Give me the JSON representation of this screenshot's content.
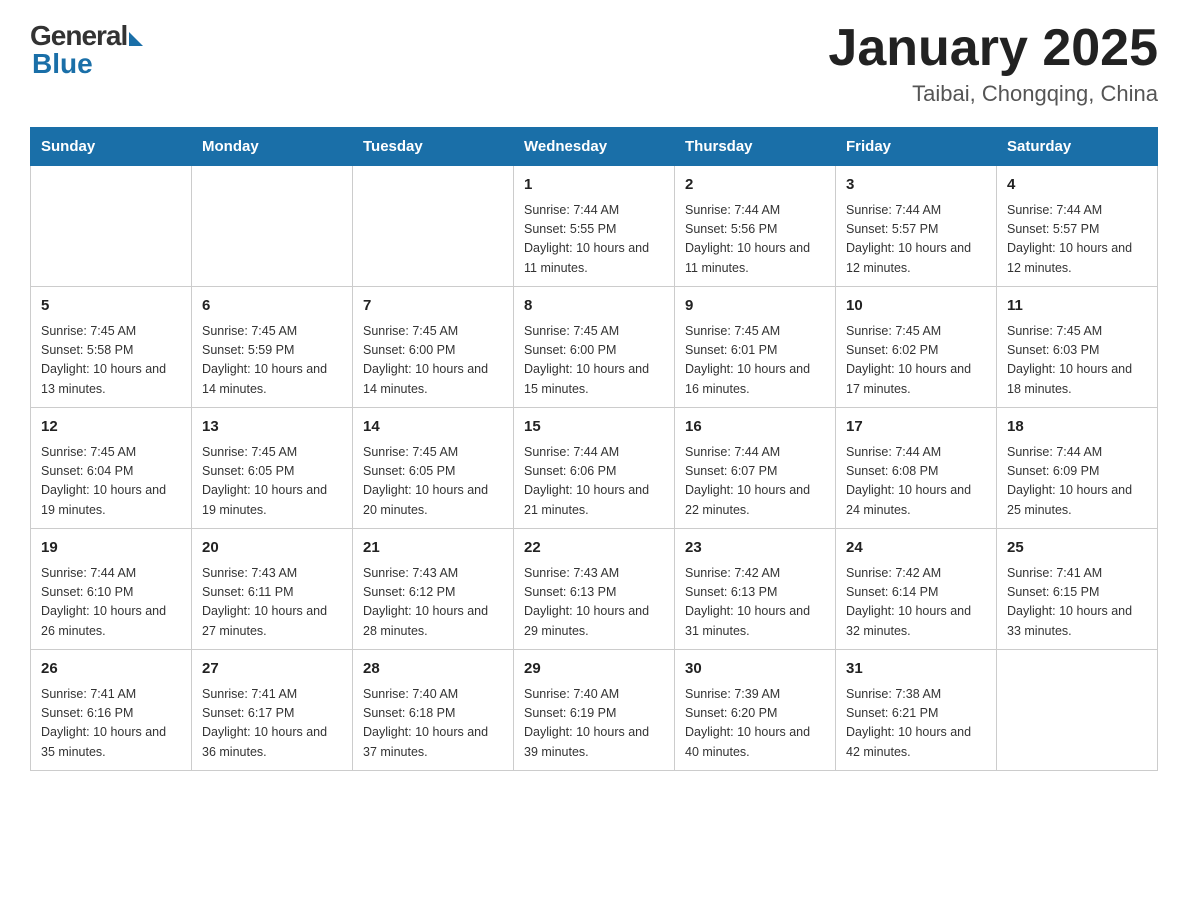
{
  "header": {
    "logo_general": "General",
    "logo_blue": "Blue",
    "month_title": "January 2025",
    "location": "Taibai, Chongqing, China"
  },
  "days_of_week": [
    "Sunday",
    "Monday",
    "Tuesday",
    "Wednesday",
    "Thursday",
    "Friday",
    "Saturday"
  ],
  "weeks": [
    [
      {
        "day": "",
        "info": ""
      },
      {
        "day": "",
        "info": ""
      },
      {
        "day": "",
        "info": ""
      },
      {
        "day": "1",
        "info": "Sunrise: 7:44 AM\nSunset: 5:55 PM\nDaylight: 10 hours\nand 11 minutes."
      },
      {
        "day": "2",
        "info": "Sunrise: 7:44 AM\nSunset: 5:56 PM\nDaylight: 10 hours\nand 11 minutes."
      },
      {
        "day": "3",
        "info": "Sunrise: 7:44 AM\nSunset: 5:57 PM\nDaylight: 10 hours\nand 12 minutes."
      },
      {
        "day": "4",
        "info": "Sunrise: 7:44 AM\nSunset: 5:57 PM\nDaylight: 10 hours\nand 12 minutes."
      }
    ],
    [
      {
        "day": "5",
        "info": "Sunrise: 7:45 AM\nSunset: 5:58 PM\nDaylight: 10 hours\nand 13 minutes."
      },
      {
        "day": "6",
        "info": "Sunrise: 7:45 AM\nSunset: 5:59 PM\nDaylight: 10 hours\nand 14 minutes."
      },
      {
        "day": "7",
        "info": "Sunrise: 7:45 AM\nSunset: 6:00 PM\nDaylight: 10 hours\nand 14 minutes."
      },
      {
        "day": "8",
        "info": "Sunrise: 7:45 AM\nSunset: 6:00 PM\nDaylight: 10 hours\nand 15 minutes."
      },
      {
        "day": "9",
        "info": "Sunrise: 7:45 AM\nSunset: 6:01 PM\nDaylight: 10 hours\nand 16 minutes."
      },
      {
        "day": "10",
        "info": "Sunrise: 7:45 AM\nSunset: 6:02 PM\nDaylight: 10 hours\nand 17 minutes."
      },
      {
        "day": "11",
        "info": "Sunrise: 7:45 AM\nSunset: 6:03 PM\nDaylight: 10 hours\nand 18 minutes."
      }
    ],
    [
      {
        "day": "12",
        "info": "Sunrise: 7:45 AM\nSunset: 6:04 PM\nDaylight: 10 hours\nand 19 minutes."
      },
      {
        "day": "13",
        "info": "Sunrise: 7:45 AM\nSunset: 6:05 PM\nDaylight: 10 hours\nand 19 minutes."
      },
      {
        "day": "14",
        "info": "Sunrise: 7:45 AM\nSunset: 6:05 PM\nDaylight: 10 hours\nand 20 minutes."
      },
      {
        "day": "15",
        "info": "Sunrise: 7:44 AM\nSunset: 6:06 PM\nDaylight: 10 hours\nand 21 minutes."
      },
      {
        "day": "16",
        "info": "Sunrise: 7:44 AM\nSunset: 6:07 PM\nDaylight: 10 hours\nand 22 minutes."
      },
      {
        "day": "17",
        "info": "Sunrise: 7:44 AM\nSunset: 6:08 PM\nDaylight: 10 hours\nand 24 minutes."
      },
      {
        "day": "18",
        "info": "Sunrise: 7:44 AM\nSunset: 6:09 PM\nDaylight: 10 hours\nand 25 minutes."
      }
    ],
    [
      {
        "day": "19",
        "info": "Sunrise: 7:44 AM\nSunset: 6:10 PM\nDaylight: 10 hours\nand 26 minutes."
      },
      {
        "day": "20",
        "info": "Sunrise: 7:43 AM\nSunset: 6:11 PM\nDaylight: 10 hours\nand 27 minutes."
      },
      {
        "day": "21",
        "info": "Sunrise: 7:43 AM\nSunset: 6:12 PM\nDaylight: 10 hours\nand 28 minutes."
      },
      {
        "day": "22",
        "info": "Sunrise: 7:43 AM\nSunset: 6:13 PM\nDaylight: 10 hours\nand 29 minutes."
      },
      {
        "day": "23",
        "info": "Sunrise: 7:42 AM\nSunset: 6:13 PM\nDaylight: 10 hours\nand 31 minutes."
      },
      {
        "day": "24",
        "info": "Sunrise: 7:42 AM\nSunset: 6:14 PM\nDaylight: 10 hours\nand 32 minutes."
      },
      {
        "day": "25",
        "info": "Sunrise: 7:41 AM\nSunset: 6:15 PM\nDaylight: 10 hours\nand 33 minutes."
      }
    ],
    [
      {
        "day": "26",
        "info": "Sunrise: 7:41 AM\nSunset: 6:16 PM\nDaylight: 10 hours\nand 35 minutes."
      },
      {
        "day": "27",
        "info": "Sunrise: 7:41 AM\nSunset: 6:17 PM\nDaylight: 10 hours\nand 36 minutes."
      },
      {
        "day": "28",
        "info": "Sunrise: 7:40 AM\nSunset: 6:18 PM\nDaylight: 10 hours\nand 37 minutes."
      },
      {
        "day": "29",
        "info": "Sunrise: 7:40 AM\nSunset: 6:19 PM\nDaylight: 10 hours\nand 39 minutes."
      },
      {
        "day": "30",
        "info": "Sunrise: 7:39 AM\nSunset: 6:20 PM\nDaylight: 10 hours\nand 40 minutes."
      },
      {
        "day": "31",
        "info": "Sunrise: 7:38 AM\nSunset: 6:21 PM\nDaylight: 10 hours\nand 42 minutes."
      },
      {
        "day": "",
        "info": ""
      }
    ]
  ],
  "colors": {
    "header_bg": "#1a6fa8",
    "header_text": "#ffffff",
    "border": "#cccccc"
  }
}
